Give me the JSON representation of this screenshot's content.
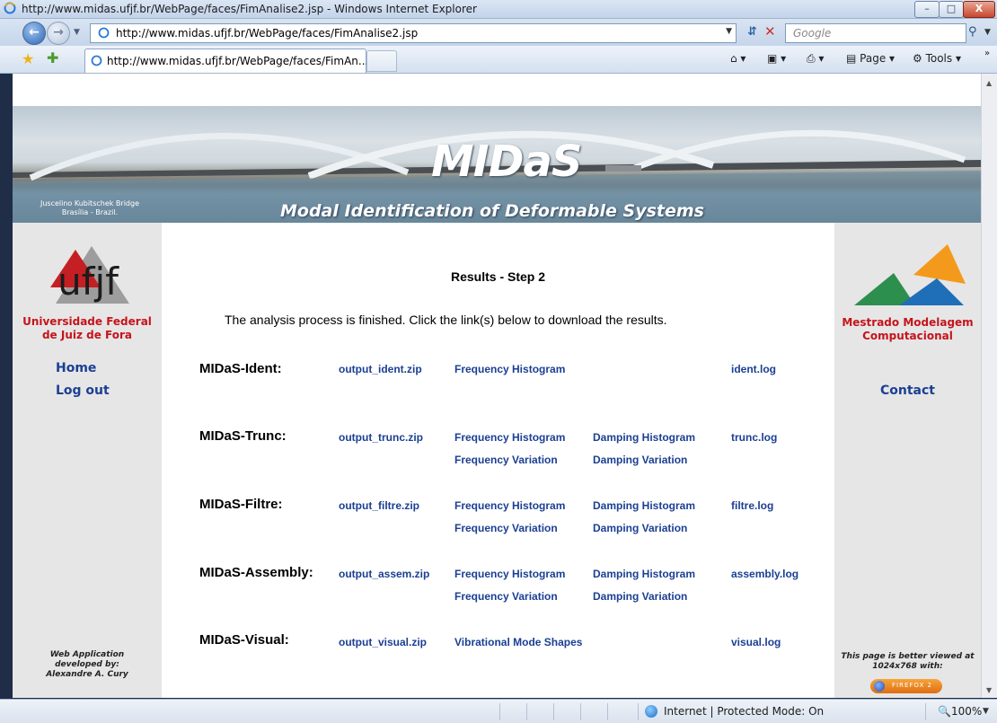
{
  "window": {
    "title": "http://www.midas.ufjf.br/WebPage/faces/FimAnalise2.jsp - Windows Internet Explorer",
    "buttons": {
      "minimize": "–",
      "maximize": "□",
      "close": "X"
    }
  },
  "address_bar": {
    "url": "http://www.midas.ufjf.br/WebPage/faces/FimAnalise2.jsp",
    "search_placeholder": "Google"
  },
  "tabs": [
    {
      "label": "http://www.midas.ufjf.br/WebPage/faces/FimAn..."
    }
  ],
  "command_bar": {
    "page": "Page ▾",
    "tools": "Tools ▾",
    "overflow": "»"
  },
  "banner": {
    "title": "MIDaS",
    "subtitle": "Modal Identification of Deformable Systems",
    "caption_line1": "Juscelino Kubitschek Bridge",
    "caption_line2": "Brasília - Brazil."
  },
  "left_sidebar": {
    "logo_text": "ufjf",
    "university_line1": "Universidade Federal",
    "university_line2": "de Juiz de Fora",
    "nav": [
      {
        "label": "Home"
      },
      {
        "label": "Log out"
      }
    ],
    "credit_line1": "Web Application",
    "credit_line2": "developed by:",
    "credit_line3": "Alexandre A. Cury"
  },
  "right_sidebar": {
    "program_line1": "Mestrado Modelagem",
    "program_line2": "Computacional",
    "contact": "Contact",
    "note_line1": "This page is better viewed at",
    "note_line2": "1024x768 with:",
    "badge": "FIREFOX 2"
  },
  "main": {
    "heading": "Results - Step 2",
    "intro": "The analysis process is finished. Click the link(s) below to download the results.",
    "modules": [
      {
        "name": "MIDaS-Ident:",
        "zip": "output_ident.zip",
        "links": [
          "Frequency Histogram"
        ],
        "log": "ident.log"
      },
      {
        "name": "MIDaS-Trunc:",
        "zip": "output_trunc.zip",
        "links": [
          "Frequency Histogram",
          "Damping Histogram",
          "Frequency Variation",
          "Damping Variation"
        ],
        "log": "trunc.log"
      },
      {
        "name": "MIDaS-Filtre:",
        "zip": "output_filtre.zip",
        "links": [
          "Frequency Histogram",
          "Damping Histogram",
          "Frequency Variation",
          "Damping Variation"
        ],
        "log": "filtre.log"
      },
      {
        "name": "MIDaS-Assembly:",
        "zip": "output_assem.zip",
        "links": [
          "Frequency Histogram",
          "Damping Histogram",
          "Frequency Variation",
          "Damping Variation"
        ],
        "log": "assembly.log"
      },
      {
        "name": "MIDaS-Visual:",
        "zip": "output_visual.zip",
        "links": [
          "Vibrational Mode Shapes"
        ],
        "log": "visual.log"
      }
    ]
  },
  "status_bar": {
    "zone": "Internet | Protected Mode: On",
    "zoom": "100%"
  }
}
